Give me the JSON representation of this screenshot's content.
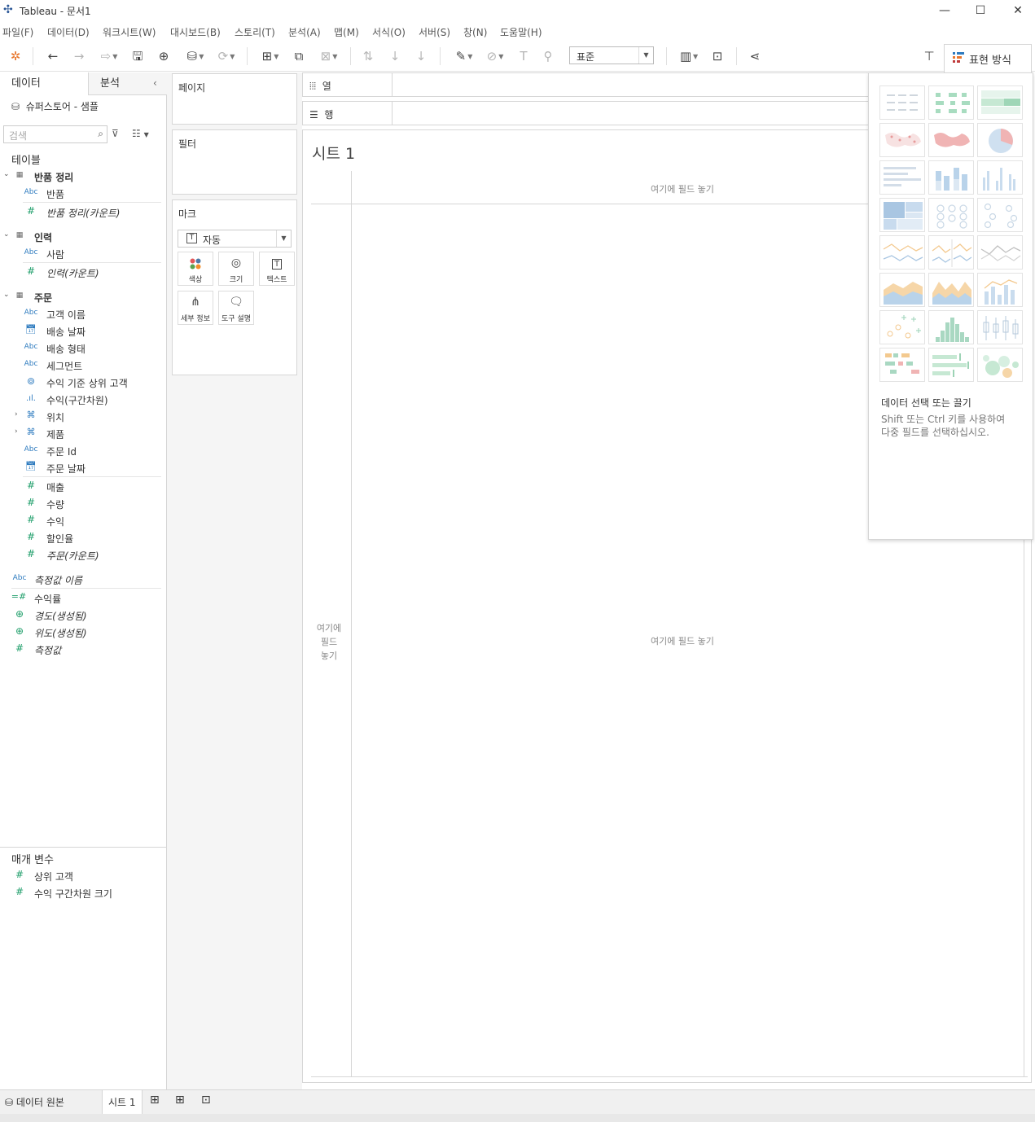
{
  "window": {
    "title": "Tableau - 문서1"
  },
  "menu": [
    "파일(F)",
    "데이터(D)",
    "워크시트(W)",
    "대시보드(B)",
    "스토리(T)",
    "분석(A)",
    "맵(M)",
    "서식(O)",
    "서버(S)",
    "창(N)",
    "도움말(H)"
  ],
  "toolbar": {
    "fit_value": "표준",
    "showme_label": "표현 방식"
  },
  "datapane": {
    "tab_data": "데이터",
    "tab_analysis": "분석",
    "datasource": "슈퍼스토어 - 샘플",
    "search_placeholder": "검색",
    "tables_header": "테이블",
    "groups": [
      {
        "name": "반품 정리",
        "fields": [
          {
            "type": "Abc",
            "name": "반품"
          },
          {
            "type": "#",
            "name": "반품 정리(카운트)"
          }
        ]
      },
      {
        "name": "인력",
        "fields": [
          {
            "type": "Abc",
            "name": "사람"
          },
          {
            "type": "#",
            "name": "인력(카운트)"
          }
        ]
      },
      {
        "name": "주문",
        "fields": [
          {
            "type": "Abc",
            "name": "고객 이름"
          },
          {
            "type": "date",
            "name": "배송 날짜"
          },
          {
            "type": "Abc",
            "name": "배송 형태"
          },
          {
            "type": "Abc",
            "name": "세그먼트"
          },
          {
            "type": "set",
            "name": "수익 기준 상위 고객"
          },
          {
            "type": "bin",
            "name": "수익(구간차원)"
          },
          {
            "type": "hier",
            "name": "위치"
          },
          {
            "type": "hier",
            "name": "제품"
          },
          {
            "type": "Abc",
            "name": "주문 Id"
          },
          {
            "type": "date",
            "name": "주문 날짜"
          },
          {
            "type": "#",
            "name": "매출"
          },
          {
            "type": "#",
            "name": "수량"
          },
          {
            "type": "#",
            "name": "수익"
          },
          {
            "type": "#",
            "name": "할인율"
          },
          {
            "type": "#",
            "name": "주문(카운트)"
          }
        ]
      }
    ],
    "extra_fields": [
      {
        "type": "Abc",
        "name": "측정값 이름"
      },
      {
        "type": "calc",
        "name": "수익률"
      },
      {
        "type": "geo",
        "name": "경도(생성됨)"
      },
      {
        "type": "geo",
        "name": "위도(생성됨)"
      },
      {
        "type": "#",
        "name": "측정값"
      }
    ],
    "params_header": "매개 변수",
    "params": [
      {
        "type": "#",
        "name": "상위 고객"
      },
      {
        "type": "#",
        "name": "수익 구간차원 크기"
      }
    ]
  },
  "cards": {
    "pages": "페이지",
    "filters": "필터",
    "marks": "마크",
    "marks_type": "자동",
    "marks_buttons": [
      "색상",
      "크기",
      "텍스트",
      "세부 정보",
      "도구 설명"
    ]
  },
  "shelves": {
    "columns": "열",
    "rows": "행"
  },
  "view": {
    "sheet_title": "시트 1",
    "drop_field_top": "여기에 필드 놓기",
    "drop_field_left_1": "여기에",
    "drop_field_left_2": "필드",
    "drop_field_left_3": "놓기",
    "drop_field_center": "여기에 필드 놓기"
  },
  "showme": {
    "hint_title": "데이터 선택 또는 끌기",
    "hint_line1": "Shift 또는 Ctrl 키를 사용하여",
    "hint_line2": "다중 필드를 선택하십시오."
  },
  "sheetbar": {
    "datasource": "데이터 원본",
    "sheet": "시트 1"
  }
}
